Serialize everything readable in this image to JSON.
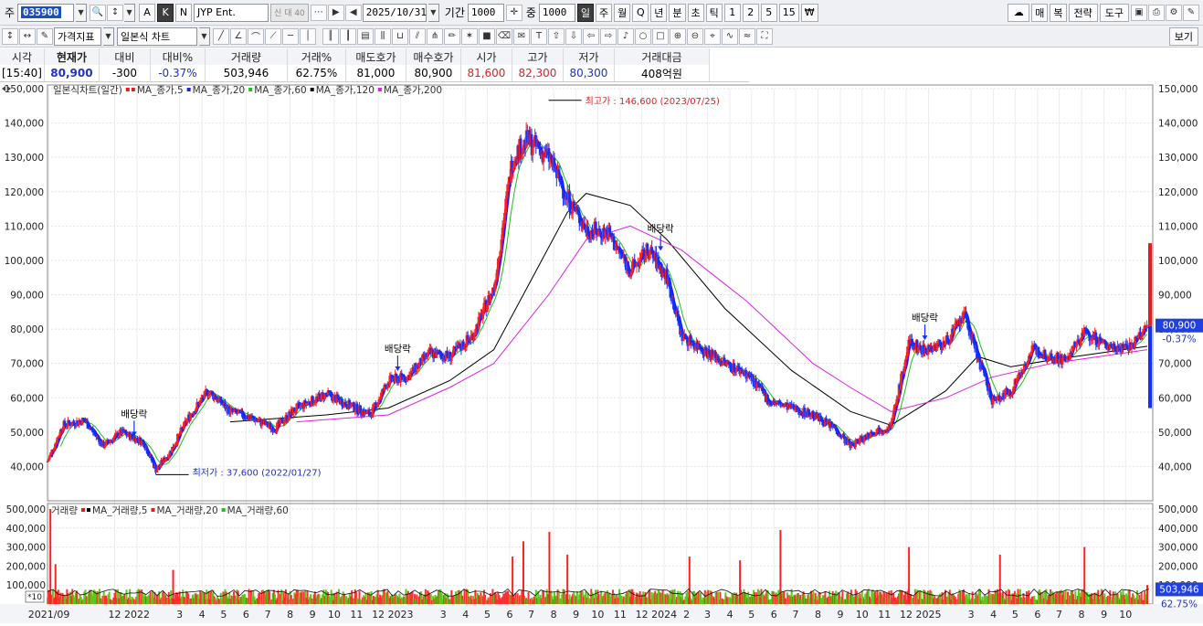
{
  "toolbar1": {
    "code_prefix": "주",
    "stock_code": "035900",
    "buttons_a": [
      "A",
      "K",
      "N"
    ],
    "stock_name": "JYP Ent.",
    "badge": "신 대 40",
    "date": "2025/10/31",
    "period_label": "기간",
    "period_value": "1000",
    "count_label": "중",
    "count_value": "1000",
    "intervals": [
      "일",
      "주",
      "월",
      "Q",
      "년",
      "분",
      "초",
      "틱",
      "1",
      "2",
      "5",
      "15",
      "₩"
    ],
    "right_buttons": [
      "매",
      "복",
      "전략",
      "도구"
    ]
  },
  "toolbar2": {
    "indicator_label": "가격지표",
    "chart_type": "일본식 차트",
    "right_button": "보기"
  },
  "quote": {
    "headers": [
      "시각",
      "현재가",
      "대비",
      "대비%",
      "거래량",
      "거래%",
      "매도호가",
      "매수호가",
      "시가",
      "고가",
      "저가",
      "거래대금"
    ],
    "values": [
      "[15:40]",
      "80,900",
      "-300",
      "-0.37%",
      "503,946",
      "62.75%",
      "81,000",
      "80,900",
      "81,600",
      "82,300",
      "80,300",
      "408억원"
    ]
  },
  "legend_price": [
    {
      "text": "일본식차트(일간)",
      "color": "#e02020"
    },
    {
      "text": "MA_종가,5",
      "color": "#e02020"
    },
    {
      "text": "MA_종가,20",
      "color": "#2020e0"
    },
    {
      "text": "MA_종가,60",
      "color": "#1fbf1f"
    },
    {
      "text": "MA_종가,120",
      "color": "#000000"
    },
    {
      "text": "MA_종가,200",
      "color": "#e020e0"
    }
  ],
  "legend_volume": [
    {
      "text": "거래량",
      "color": "#e02020"
    },
    {
      "text": "MA_거래량,5",
      "color": "#000000"
    },
    {
      "text": "MA_거래량,20",
      "color": "#e02020"
    },
    {
      "text": "MA_거래량,60",
      "color": "#1fbf1f"
    }
  ],
  "annotations": {
    "high": "최고가 : 146,600 (2023/07/25)",
    "low": "최저가 : 37,600 (2022/01/27)",
    "dividend": "배당락",
    "price_tag": "80,900",
    "change_tag": "-0.37%",
    "vol_tag": "503,946",
    "vol_pct_tag": "62.75%",
    "vol_scale": "*10"
  },
  "chart_data": {
    "type": "candlestick",
    "price_axis": {
      "min": 30000,
      "max": 150000,
      "ticks": [
        40000,
        50000,
        60000,
        70000,
        80000,
        90000,
        100000,
        110000,
        120000,
        130000,
        140000,
        150000
      ]
    },
    "volume_axis": {
      "min": 0,
      "max": 500000,
      "ticks": [
        100000,
        200000,
        300000,
        400000,
        500000
      ]
    },
    "x_labels": [
      "2021/09",
      "12",
      "2022",
      "3",
      "4",
      "5",
      "6",
      "7",
      "8",
      "9",
      "10",
      "11",
      "12",
      "2023",
      "3",
      "4",
      "5",
      "6",
      "7",
      "8",
      "9",
      "10",
      "11",
      "12",
      "2024",
      "2",
      "3",
      "4",
      "5",
      "6",
      "7",
      "8",
      "9",
      "10",
      "11",
      "12",
      "2025",
      "3",
      "4",
      "5",
      "6",
      "7",
      "8",
      "9",
      "10"
    ],
    "close_path": [
      [
        "2021-08-30",
        41500
      ],
      [
        "2021-09-20",
        52000
      ],
      [
        "2021-10-20",
        53500
      ],
      [
        "2021-11-15",
        46000
      ],
      [
        "2021-12-10",
        50000
      ],
      [
        "2022-01-10",
        47000
      ],
      [
        "2022-01-27",
        39000
      ],
      [
        "2022-02-15",
        44000
      ],
      [
        "2022-03-15",
        55000
      ],
      [
        "2022-04-10",
        62000
      ],
      [
        "2022-05-10",
        56000
      ],
      [
        "2022-06-10",
        54000
      ],
      [
        "2022-07-10",
        51000
      ],
      [
        "2022-08-10",
        57000
      ],
      [
        "2022-09-20",
        61000
      ],
      [
        "2022-10-20",
        58000
      ],
      [
        "2022-11-20",
        55000
      ],
      [
        "2022-12-15",
        65000
      ],
      [
        "2023-01-10",
        66000
      ],
      [
        "2023-02-10",
        73000
      ],
      [
        "2023-03-10",
        72000
      ],
      [
        "2023-04-10",
        78000
      ],
      [
        "2023-05-10",
        92000
      ],
      [
        "2023-06-05",
        130000
      ],
      [
        "2023-06-25",
        135000
      ],
      [
        "2023-07-25",
        130000
      ],
      [
        "2023-08-20",
        118000
      ],
      [
        "2023-09-15",
        109000
      ],
      [
        "2023-10-15",
        108000
      ],
      [
        "2023-11-15",
        97000
      ],
      [
        "2023-12-10",
        103000
      ],
      [
        "2024-01-05",
        95000
      ],
      [
        "2024-01-25",
        78000
      ],
      [
        "2024-02-25",
        74000
      ],
      [
        "2024-03-25",
        70000
      ],
      [
        "2024-04-25",
        67000
      ],
      [
        "2024-05-25",
        59000
      ],
      [
        "2024-06-25",
        57000
      ],
      [
        "2024-07-25",
        55000
      ],
      [
        "2024-08-25",
        51000
      ],
      [
        "2024-09-15",
        46000
      ],
      [
        "2024-10-15",
        50000
      ],
      [
        "2024-11-10",
        52000
      ],
      [
        "2024-12-05",
        76000
      ],
      [
        "2024-12-25",
        74000
      ],
      [
        "2025-01-25",
        76000
      ],
      [
        "2025-02-20",
        84000
      ],
      [
        "2025-03-10",
        72000
      ],
      [
        "2025-03-30",
        59000
      ],
      [
        "2025-04-25",
        62000
      ],
      [
        "2025-05-25",
        74000
      ],
      [
        "2025-06-20",
        72000
      ],
      [
        "2025-07-10",
        71000
      ],
      [
        "2025-08-05",
        79000
      ],
      [
        "2025-09-05",
        75000
      ],
      [
        "2025-10-10",
        75000
      ],
      [
        "2025-10-31",
        80900
      ]
    ],
    "ma200_path": [
      [
        "2022-08-10",
        53000
      ],
      [
        "2022-12-15",
        55000
      ],
      [
        "2023-03-10",
        63000
      ],
      [
        "2023-05-10",
        70000
      ],
      [
        "2023-07-25",
        90000
      ],
      [
        "2023-09-15",
        106000
      ],
      [
        "2023-11-15",
        110000
      ],
      [
        "2024-01-25",
        103000
      ],
      [
        "2024-04-25",
        88000
      ],
      [
        "2024-07-25",
        70000
      ],
      [
        "2024-09-15",
        63000
      ],
      [
        "2024-11-10",
        56000
      ],
      [
        "2025-01-25",
        60000
      ],
      [
        "2025-03-30",
        66000
      ],
      [
        "2025-06-20",
        70000
      ],
      [
        "2025-10-31",
        74000
      ]
    ],
    "ma120_path": [
      [
        "2022-05-10",
        53000
      ],
      [
        "2022-09-20",
        55000
      ],
      [
        "2022-12-15",
        57000
      ],
      [
        "2023-03-10",
        65000
      ],
      [
        "2023-05-10",
        74000
      ],
      [
        "2023-06-25",
        92000
      ],
      [
        "2023-08-20",
        114000
      ],
      [
        "2023-09-15",
        119500
      ],
      [
        "2023-11-15",
        116000
      ],
      [
        "2024-01-05",
        106000
      ],
      [
        "2024-03-25",
        86000
      ],
      [
        "2024-06-25",
        68000
      ],
      [
        "2024-09-15",
        56000
      ],
      [
        "2024-11-10",
        52000
      ],
      [
        "2025-01-25",
        62000
      ],
      [
        "2025-03-10",
        72000
      ],
      [
        "2025-04-25",
        69000
      ],
      [
        "2025-06-20",
        71000
      ],
      [
        "2025-10-31",
        75000
      ]
    ],
    "volume_spikes": [
      [
        "2021-09-03",
        500000
      ],
      [
        "2021-09-10",
        210000
      ],
      [
        "2022-02-20",
        180000
      ],
      [
        "2023-06-05",
        250000
      ],
      [
        "2023-06-20",
        330000
      ],
      [
        "2023-07-26",
        380000
      ],
      [
        "2023-08-20",
        260000
      ],
      [
        "2024-02-05",
        250000
      ],
      [
        "2024-04-15",
        230000
      ],
      [
        "2024-06-10",
        390000
      ],
      [
        "2024-12-05",
        300000
      ],
      [
        "2025-04-10",
        260000
      ],
      [
        "2025-08-05",
        300000
      ],
      [
        "2025-10-31",
        100000
      ]
    ],
    "dividend_markers": [
      [
        "2021-12-28",
        48000
      ],
      [
        "2022-12-28",
        67000
      ],
      [
        "2023-12-27",
        102000
      ],
      [
        "2024-12-27",
        76000
      ]
    ],
    "high": [
      "2023-07-25",
      146600
    ],
    "low": [
      "2022-01-27",
      37600
    ]
  }
}
